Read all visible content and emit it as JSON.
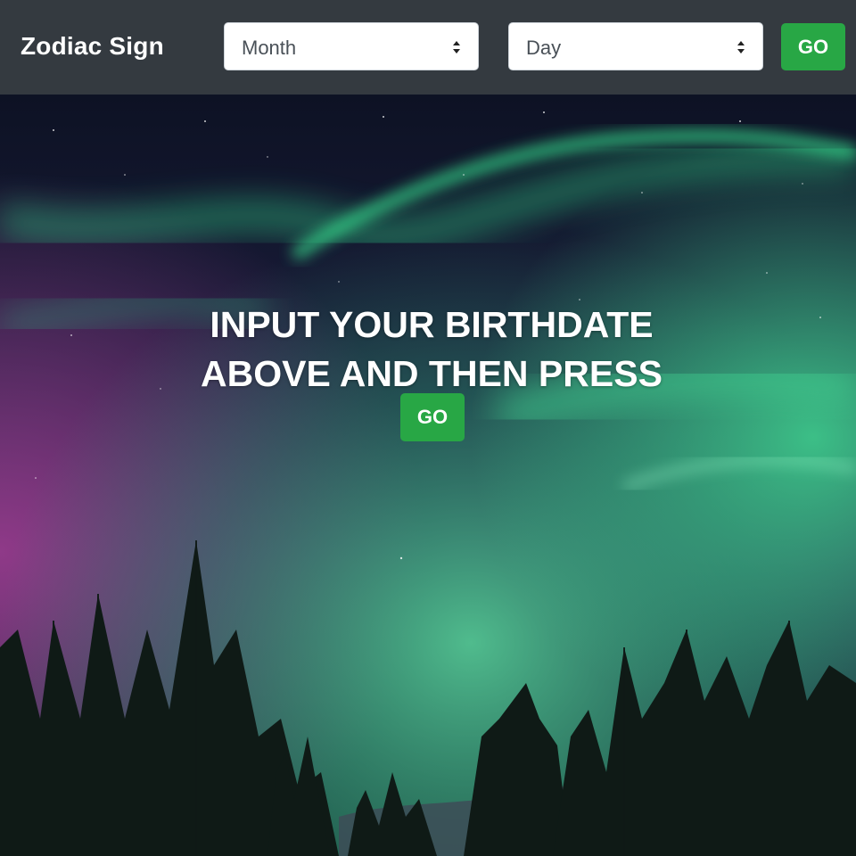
{
  "navbar": {
    "brand": "Zodiac Sign",
    "month_select": {
      "selected": "Month"
    },
    "day_select": {
      "selected": "Day"
    },
    "go_label": "GO"
  },
  "hero": {
    "line1": "INPUT YOUR BIRTHDATE",
    "line2": "ABOVE AND THEN PRESS",
    "go_label": "GO",
    "background": "aurora-night-sky-with-pine-trees"
  },
  "colors": {
    "navbar_bg": "#343a40",
    "go_button": "#28a745",
    "aurora_green": "#2fd388",
    "aurora_purple": "#8a3a8c"
  },
  "icons": {
    "select_arrows": "sort-arrows-icon"
  }
}
